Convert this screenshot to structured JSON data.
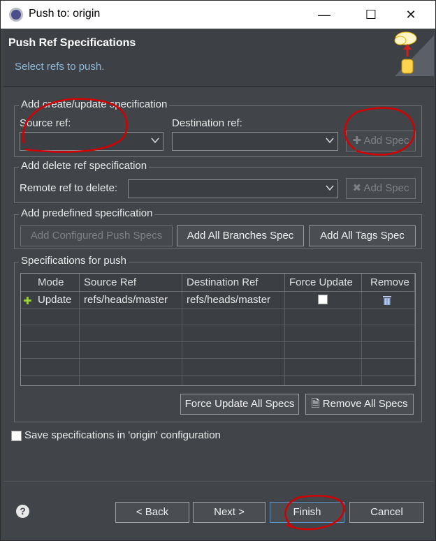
{
  "window": {
    "title": "Push to: origin",
    "minimize": "—",
    "maximize": "☐",
    "close": "✕"
  },
  "header": {
    "title": "Push Ref Specifications",
    "subtitle": "Select refs to push."
  },
  "create_group": {
    "legend": "Add create/update specification",
    "source_label": "Source ref:",
    "source_value": "",
    "dest_label": "Destination ref:",
    "dest_value": "",
    "add_spec": "Add Spec"
  },
  "delete_group": {
    "legend": "Add delete ref specification",
    "remote_label": "Remote ref to delete:",
    "remote_value": "",
    "add_spec": "Add Spec"
  },
  "predefined_group": {
    "legend": "Add predefined specification",
    "configured": "Add Configured Push Specs",
    "all_branches": "Add All Branches Spec",
    "all_tags": "Add All Tags Spec"
  },
  "specs_group": {
    "legend": "Specifications for push",
    "columns": [
      "Mode",
      "Source Ref",
      "Destination Ref",
      "Force Update",
      "Remove"
    ],
    "rows": [
      {
        "mode": "Update",
        "source": "refs/heads/master",
        "dest": "refs/heads/master",
        "force": false
      }
    ],
    "force_all": "Force Update All Specs",
    "remove_all": "Remove All Specs"
  },
  "save_config": {
    "label": "Save specifications in 'origin' configuration",
    "checked": false
  },
  "footer": {
    "help": "?",
    "back": "< Back",
    "next": "Next >",
    "finish": "Finish",
    "cancel": "Cancel"
  },
  "colors": {
    "background": "#414549",
    "accent": "#8fb9d8",
    "annotation": "#d40000"
  }
}
